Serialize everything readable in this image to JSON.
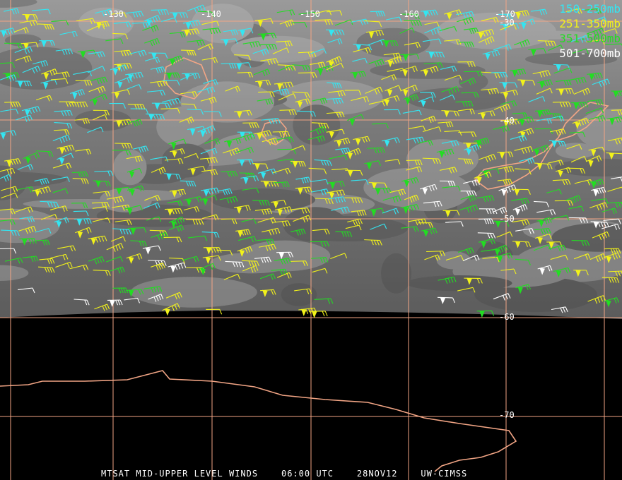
{
  "map": {
    "satellite": "MTSAT",
    "product": "MID-UPPER LEVEL WINDS",
    "time": "06:00 UTC",
    "date": "28NOV12",
    "source": "UW-CIMSS",
    "longitude_labels": [
      "-130",
      "-140",
      "-150",
      "-160",
      "-170"
    ],
    "latitude_labels": [
      "-30",
      "-40",
      "-50",
      "-60",
      "-70"
    ]
  },
  "legend": [
    {
      "label": "150-250mb",
      "color": "#33e6f2"
    },
    {
      "label": "251-350mb",
      "color": "#f2f21a"
    },
    {
      "label": "351-500mb",
      "color": "#22dd22"
    },
    {
      "label": "501-700mb",
      "color": "#ffffff"
    }
  ],
  "colors": {
    "grid": "#f2a585",
    "coast": "#f2a585",
    "imagery": "#707070",
    "space": "#000000"
  }
}
